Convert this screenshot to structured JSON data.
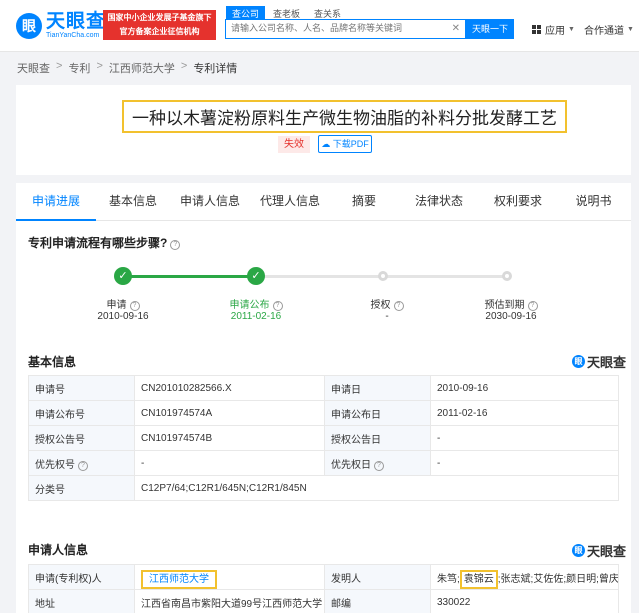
{
  "header": {
    "logo_cn": "天眼查",
    "logo_en": "TianYanCha.com",
    "banner_line1": "国家中小企业发展子基金旗下",
    "banner_line2": "官方备案企业征信机构",
    "search_tabs": [
      "查公司",
      "查老板",
      "查关系"
    ],
    "search_placeholder": "请输入公司名称、人名、品牌名称等关键词",
    "search_button": "天眼一下",
    "apps_label": "应用",
    "partner_label": "合作通道"
  },
  "breadcrumb": [
    "天眼查",
    "专利",
    "江西师范大学",
    "专利详情"
  ],
  "patent": {
    "title": "一种以木薯淀粉原料生产微生物油脂的补料分批发酵工艺",
    "status": "失效",
    "pdf_button": "下载PDF"
  },
  "tabs": [
    "申请进展",
    "基本信息",
    "申请人信息",
    "代理人信息",
    "摘要",
    "法律状态",
    "权利要求",
    "说明书"
  ],
  "progress": {
    "title": "专利申请流程有哪些步骤?",
    "steps": [
      {
        "label": "申请",
        "date": "2010-09-16",
        "done": true
      },
      {
        "label": "申请公布",
        "date": "2011-02-16",
        "done": true
      },
      {
        "label": "授权",
        "date": "-",
        "done": false
      },
      {
        "label": "预估到期",
        "date": "2030-09-16",
        "done": false
      }
    ]
  },
  "basic": {
    "title": "基本信息",
    "brand": "天眼查",
    "rows": [
      {
        "k1": "申请号",
        "v1": "CN201010282566.X",
        "k2": "申请日",
        "v2": "2010-09-16"
      },
      {
        "k1": "申请公布号",
        "v1": "CN101974574A",
        "k2": "申请公布日",
        "v2": "2011-02-16"
      },
      {
        "k1": "授权公告号",
        "v1": "CN101974574B",
        "k2": "授权公告日",
        "v2": "-"
      },
      {
        "k1": "优先权号",
        "v1": "-",
        "k2": "优先权日",
        "v2": "-"
      }
    ],
    "class_key": "分类号",
    "class_value": "C12P7/64;C12R1/645N;C12R1/845N"
  },
  "applicant": {
    "title": "申请人信息",
    "brand": "天眼查",
    "applicant_key": "申请(专利权)人",
    "applicant_value": "江西师范大学",
    "inventor_key": "发明人",
    "inventor_before": "朱笃;",
    "inventor_highlight": "袁锦云",
    "inventor_after": ";张志斌;艾佐佐;颜日明;曾庆桂",
    "address_key": "地址",
    "address_value": "江西省南昌市紫阳大道99号江西师范大学",
    "postcode_key": "邮编",
    "postcode_value": "330022"
  }
}
